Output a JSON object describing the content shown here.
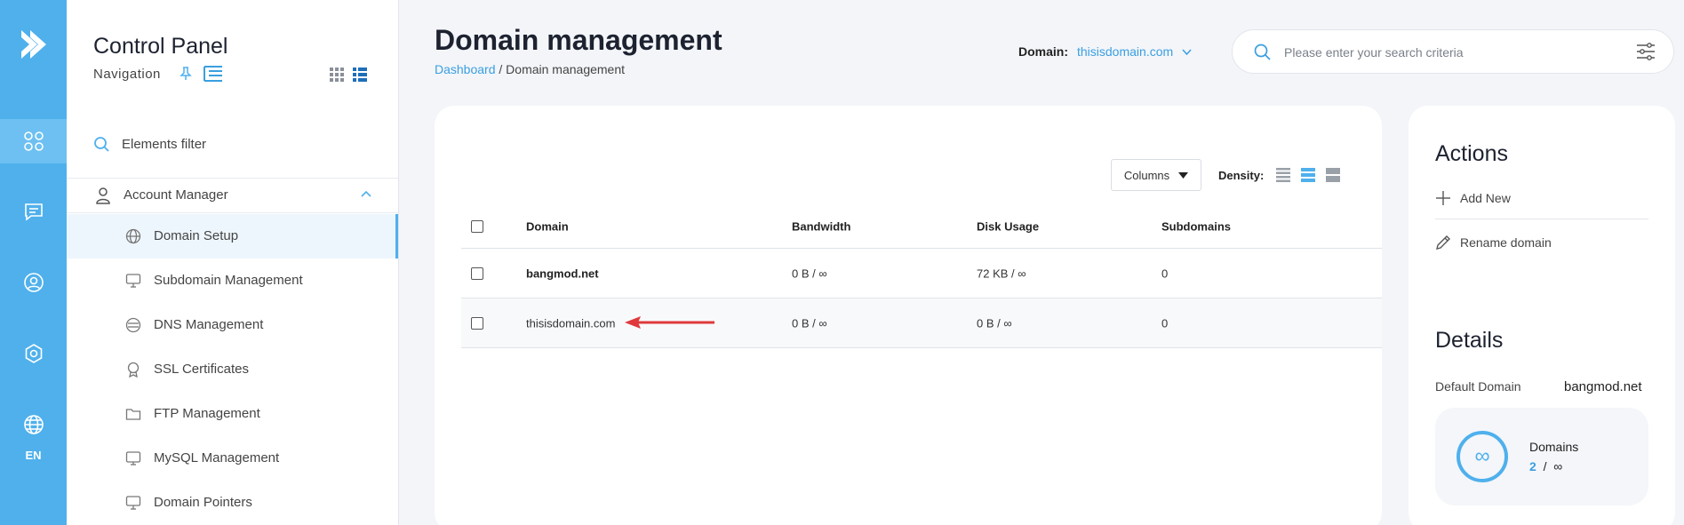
{
  "rail": {
    "items": [
      {
        "icon": "apps-icon",
        "active": true
      },
      {
        "icon": "message-icon",
        "active": false
      },
      {
        "icon": "user-circle-icon",
        "active": false
      },
      {
        "icon": "settings-icon",
        "active": false
      },
      {
        "icon": "globe-icon",
        "active": false
      }
    ],
    "lang": "EN"
  },
  "nav": {
    "title": "Control Panel",
    "subtitle": "Navigation",
    "filter": "Elements filter",
    "group": "Account Manager",
    "items": [
      {
        "label": "Domain Setup",
        "icon": "globe-icon",
        "active": true
      },
      {
        "label": "Subdomain Management",
        "icon": "monitor-icon",
        "active": false
      },
      {
        "label": "DNS Management",
        "icon": "dns-icon",
        "active": false
      },
      {
        "label": "SSL Certificates",
        "icon": "certificate-icon",
        "active": false
      },
      {
        "label": "FTP Management",
        "icon": "ftp-folder-icon",
        "active": false
      },
      {
        "label": "MySQL Management",
        "icon": "database-icon",
        "active": false
      },
      {
        "label": "Domain Pointers",
        "icon": "pointer-icon",
        "active": false
      }
    ]
  },
  "header": {
    "title": "Domain management",
    "breadcrumb": {
      "link": "Dashboard",
      "sep": " / ",
      "current": "Domain management"
    },
    "domain_label": "Domain:",
    "domain_value": "thisisdomain.com",
    "search_placeholder": "Please enter your search criteria"
  },
  "toolbar": {
    "columns_label": "Columns",
    "density_label": "Density:"
  },
  "table": {
    "columns": [
      "Domain",
      "Bandwidth",
      "Disk Usage",
      "Subdomains"
    ],
    "rows": [
      {
        "domain": "bangmod.net",
        "bandwidth": "0 B / ∞",
        "disk": "72 KB / ∞",
        "subdomains": "0"
      },
      {
        "domain": "thisisdomain.com",
        "bandwidth": "0 B / ∞",
        "disk": "0 B / ∞",
        "subdomains": "0"
      }
    ]
  },
  "side": {
    "actions_title": "Actions",
    "add_new": "Add New",
    "rename": "Rename domain",
    "details_title": "Details",
    "default_domain_label": "Default Domain",
    "default_domain_value": "bangmod.net",
    "domains_label": "Domains",
    "domains_used": "2",
    "domains_sep": "/",
    "domains_limit": "∞",
    "infinity_glyph": "∞"
  },
  "colors": {
    "accent": "#4fb0ec",
    "link": "#3a9fe0",
    "arrow": "#e0393b"
  }
}
